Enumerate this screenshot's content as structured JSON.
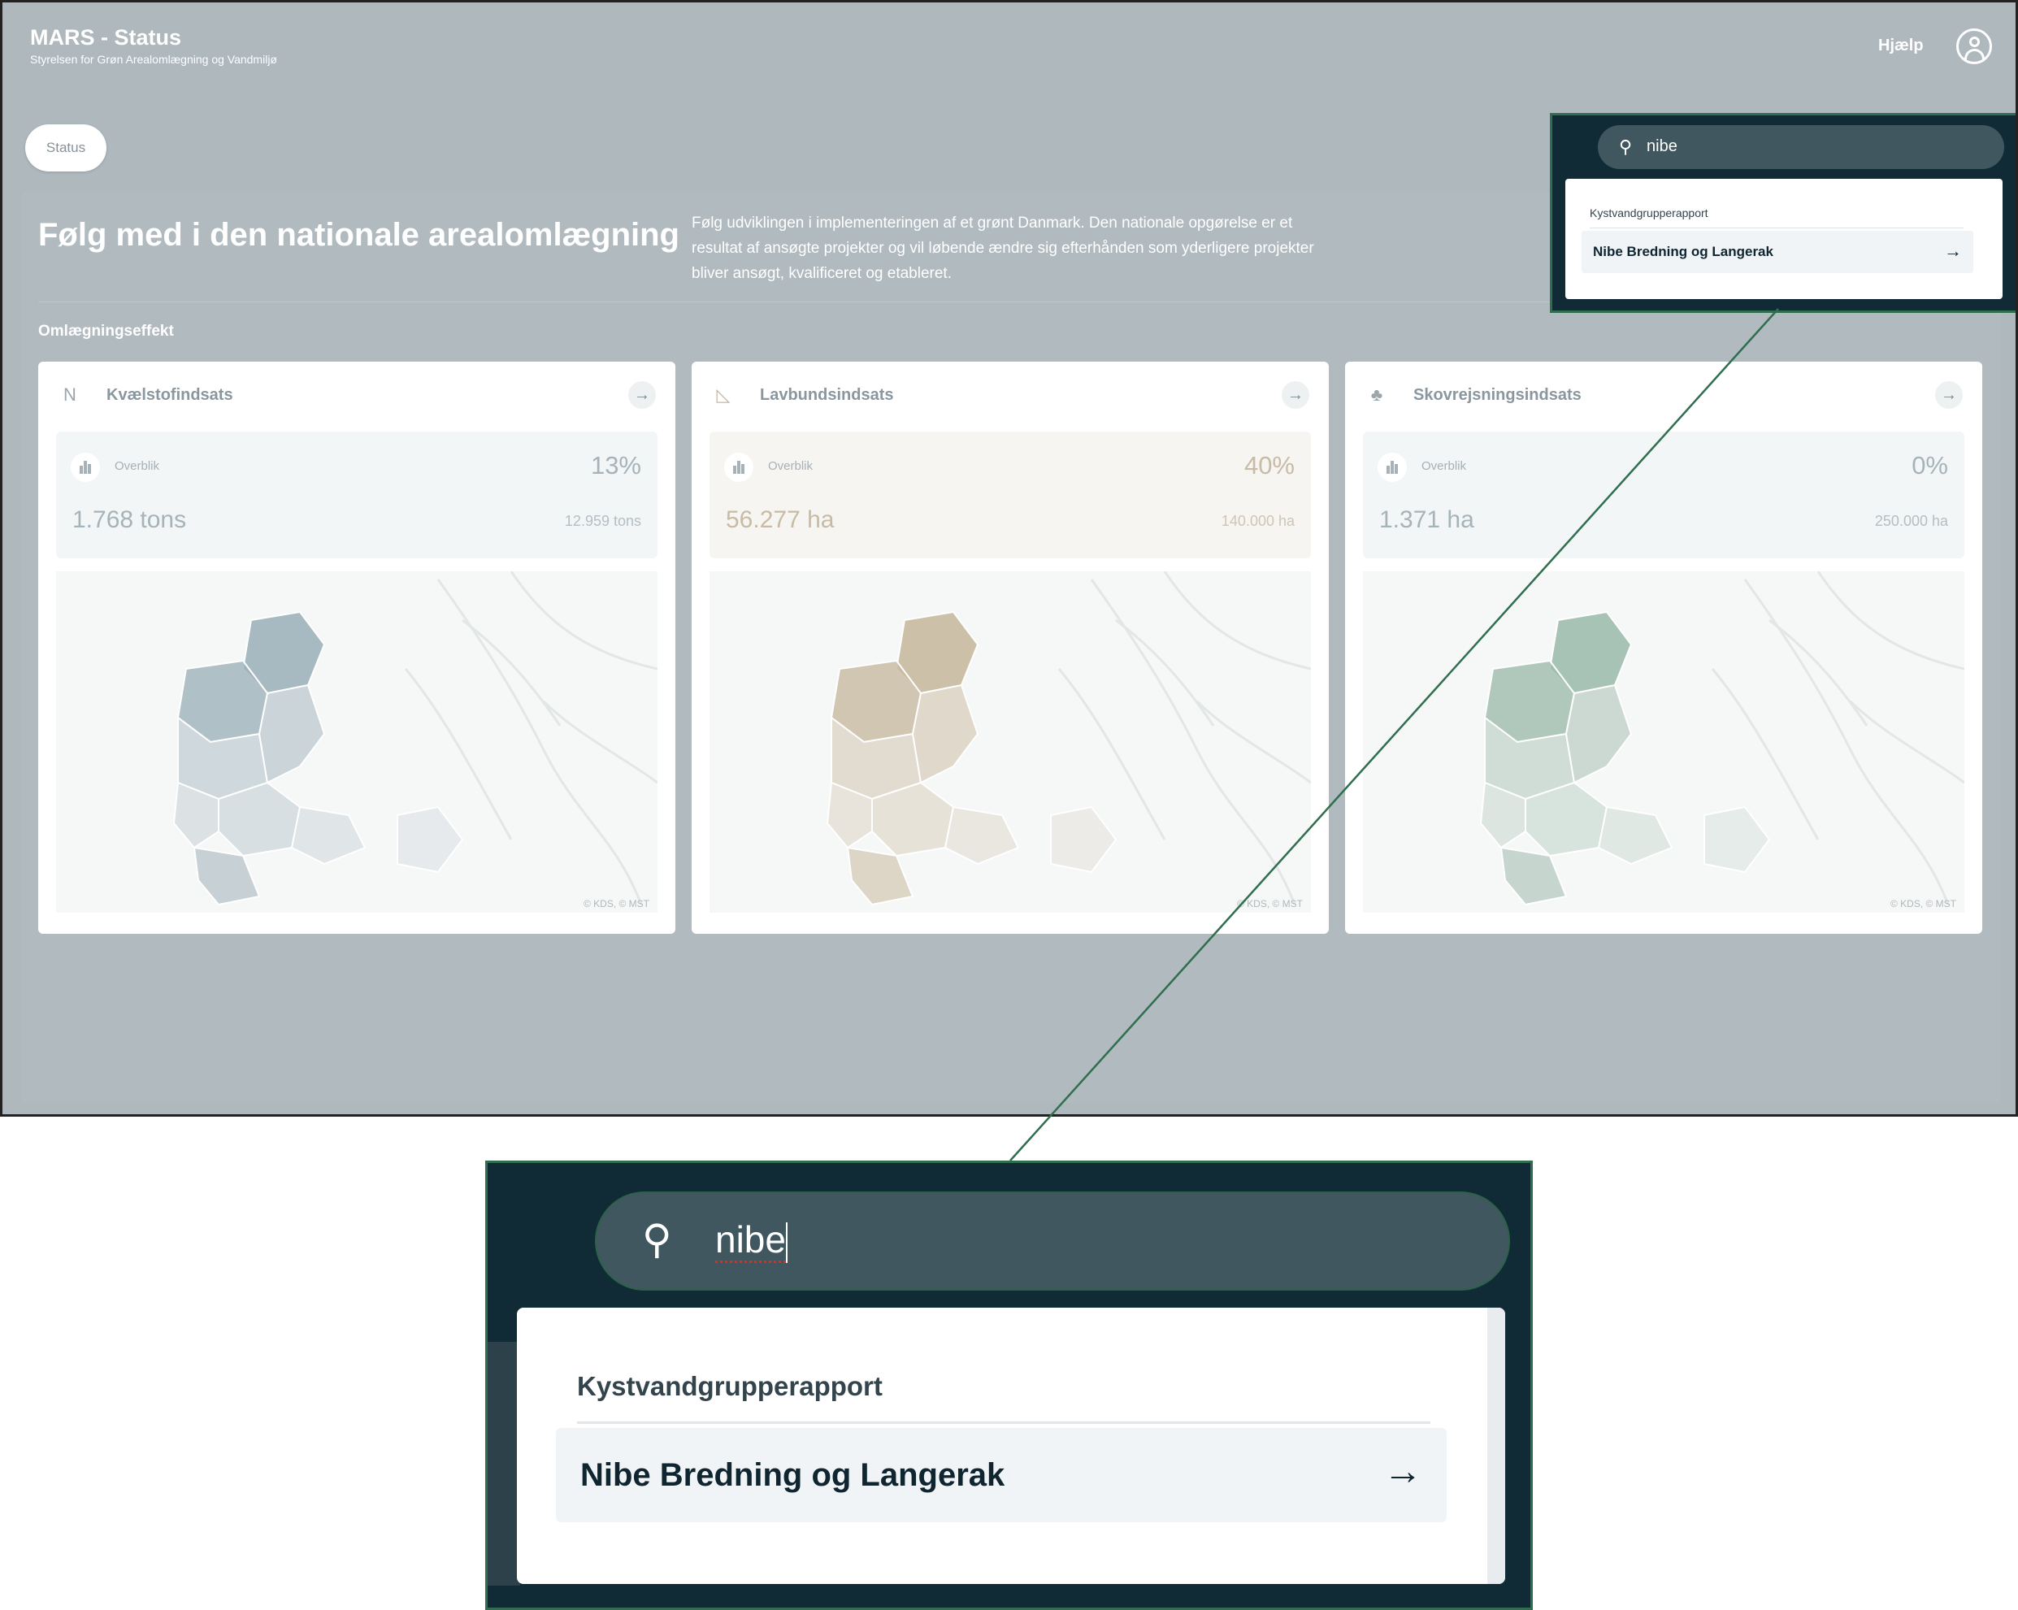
{
  "header": {
    "title": "MARS - Status",
    "subtitle": "Styrelsen for Grøn Arealomlægning og Vandmiljø",
    "help_label": "Hjælp",
    "user_icon": "user-circle-icon"
  },
  "tabs": {
    "status_label": "Status"
  },
  "hero": {
    "title": "Følg med i den nationale arealomlægning",
    "description": "Følg udviklingen i implementeringen af et grønt Danmark. Den nationale opgørelse er et resultat af ansøgte projekter og vil løbende ændre sig efterhånden som yderligere projekter bliver ansøgt, kvalificeret og etableret."
  },
  "section": {
    "label": "Omlægningseffekt"
  },
  "cards": [
    {
      "icon_text": "N",
      "icon": "nitrogen-icon",
      "title": "Kvælstofindsats",
      "overview_label": "Overblik",
      "percent": "13%",
      "progress": 0.13,
      "value": "1.768 tons",
      "target": "12.959 tons",
      "map_copyright": "© KDS, © MST",
      "accent": "#9fb1ba"
    },
    {
      "icon_text": "◺",
      "icon": "lowland-icon",
      "title": "Lavbundsindsats",
      "overview_label": "Overblik",
      "percent": "40%",
      "progress": 0.4,
      "value": "56.277 ha",
      "target": "140.000 ha",
      "map_copyright": "© KDS, © MST",
      "accent": "#c8b99f"
    },
    {
      "icon_text": "♣",
      "icon": "trees-icon",
      "title": "Skovrejsningsindsats",
      "overview_label": "Overblik",
      "percent": "0%",
      "progress": 0.0,
      "value": "1.371 ha",
      "target": "250.000 ha",
      "map_copyright": "© KDS, © MST",
      "accent": "#9fbcad"
    }
  ],
  "search": {
    "query": "nibe",
    "group_label": "Kystvandgrupperapport",
    "result_label": "Nibe Bredning og Langerak",
    "search_icon": "search-icon",
    "result_icon": "arrow-right-icon"
  },
  "colors": {
    "overlay_bg": "#102a36",
    "search_bar": "#41575f",
    "highlight_border": "#2f6e4e",
    "dimmed_bg": "#aeb8bd"
  }
}
